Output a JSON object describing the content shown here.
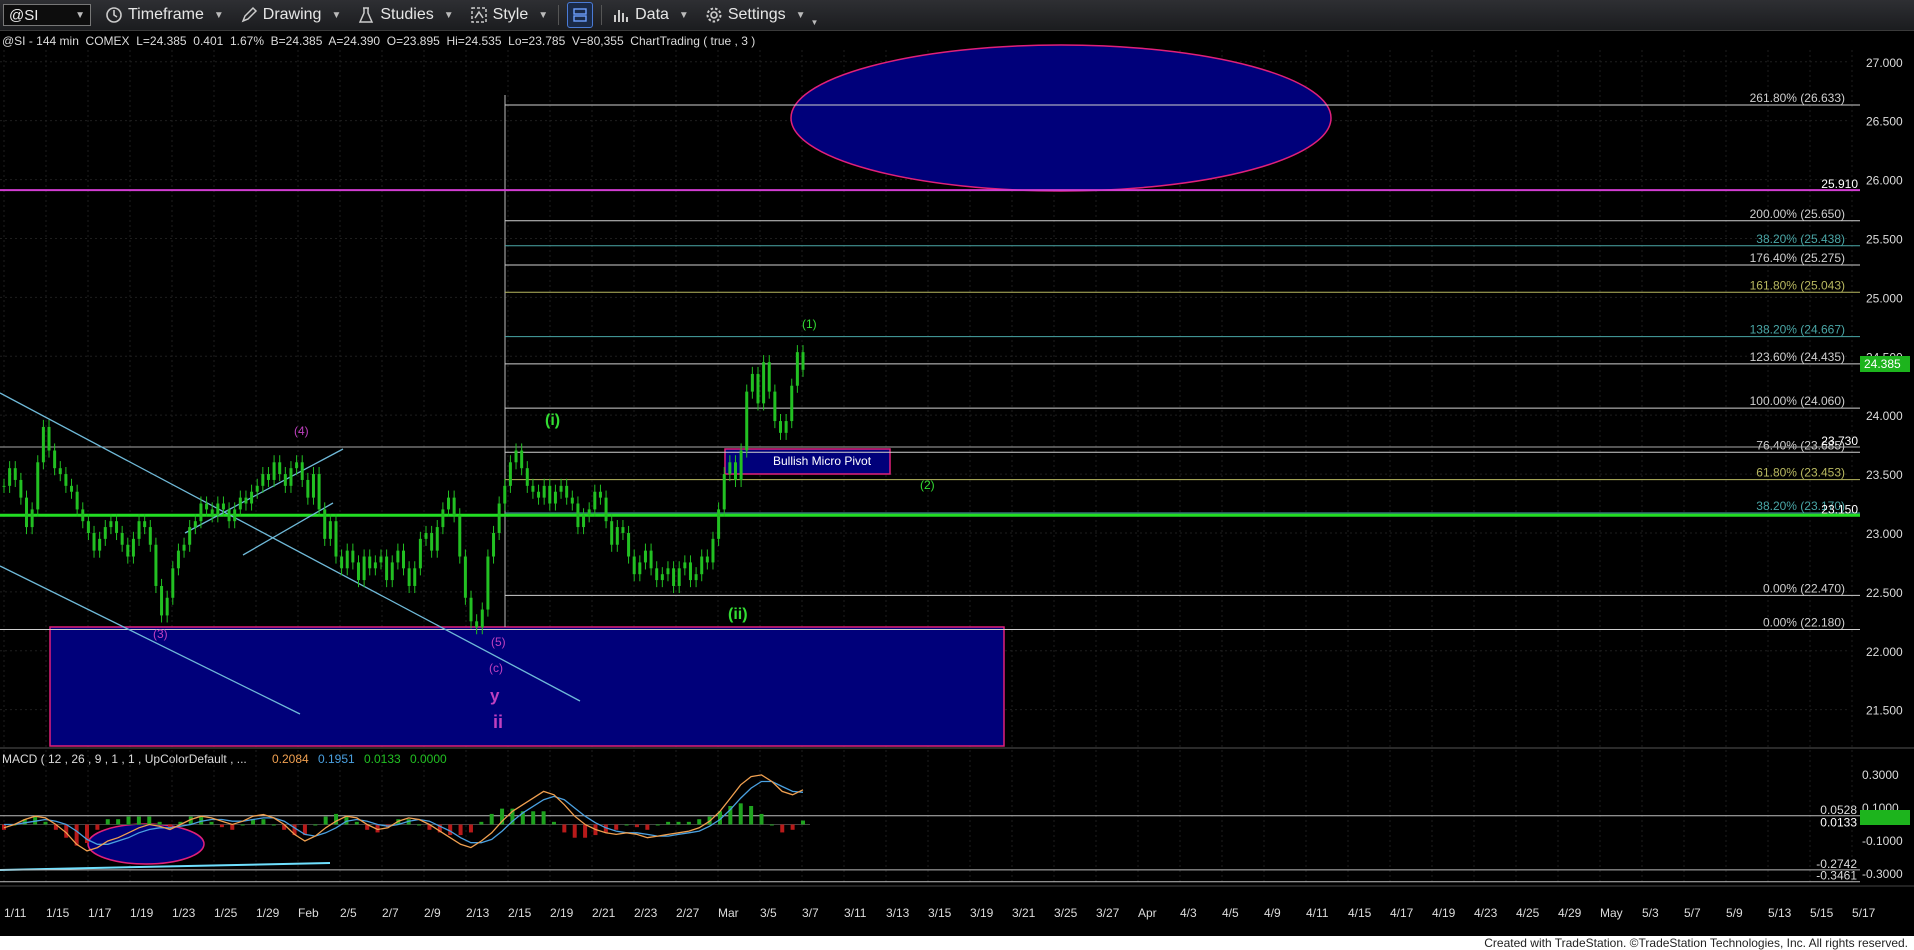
{
  "toolbar": {
    "symbol": "@SI",
    "timeframe_label": "Timeframe",
    "drawing_label": "Drawing",
    "studies_label": "Studies",
    "style_label": "Style",
    "data_label": "Data",
    "settings_label": "Settings"
  },
  "chart_header": "@SI - 144 min  COMEX  L=24.385  0.401  1.67%  B=24.385  A=24.390  O=23.895  Hi=24.535  Lo=23.785  V=80,355  ChartTrading ( true , 3 )",
  "macd_header": {
    "label": "MACD ( 12 , 26 , 9 , 1 , 1 , UpColorDefault , ...",
    "macd": "0.2084",
    "signal": "0.1951",
    "hist": "0.0133",
    "zero": "0.0000"
  },
  "footer": "Created with TradeStation. ©TradeStation Technologies, Inc. All rights reserved.",
  "colors": {
    "background": "#000000",
    "up_candle": "#22c022",
    "magenta_line": "#d23dd2",
    "green_line": "#22dd22",
    "zone_fill": "#00007a",
    "zone_border": "#e0207a",
    "label_green": "#33dd33",
    "label_magenta": "#c040c0",
    "trendline": "#6fb9d8",
    "macd_line": "#f0a050",
    "signal_line": "#4aa0e0"
  },
  "chart_data": [
    {
      "type": "line",
      "panel": "price",
      "symbol": "@SI",
      "interval": "144 min",
      "ylim": [
        21.2,
        27.1
      ],
      "y_ticks": [
        "27.000",
        "26.500",
        "26.000",
        "25.500",
        "25.000",
        "24.500",
        "24.000",
        "23.500",
        "23.000",
        "22.500",
        "22.000",
        "21.500"
      ],
      "x_ticks": [
        "1/11",
        "1/15",
        "1/17",
        "1/19",
        "1/23",
        "1/25",
        "1/29",
        "Feb",
        "2/5",
        "2/7",
        "2/9",
        "2/13",
        "2/15",
        "2/19",
        "2/21",
        "2/23",
        "2/27",
        "Mar",
        "3/5",
        "3/7",
        "3/11",
        "3/13",
        "3/15",
        "3/19",
        "3/21",
        "3/25",
        "3/27",
        "Apr",
        "4/3",
        "4/5",
        "4/9",
        "4/11",
        "4/15",
        "4/17",
        "4/19",
        "4/23",
        "4/25",
        "4/29",
        "May",
        "5/3",
        "5/7",
        "5/9",
        "5/13",
        "5/15",
        "5/17"
      ],
      "last_price": "24.385",
      "series": [
        {
          "values": [
            23.4,
            23.55,
            23.45,
            23.3,
            23.05,
            23.2,
            23.6,
            23.9,
            23.7,
            23.55,
            23.5,
            23.4,
            23.35,
            23.2,
            23.1,
            23.0,
            22.85,
            22.95,
            23.05,
            23.1,
            23.0,
            22.9,
            22.8,
            22.95,
            23.1,
            23.05,
            22.9,
            22.55,
            22.3,
            22.45,
            22.7,
            22.85,
            22.9,
            23.05,
            23.1,
            23.25,
            23.2,
            23.15,
            23.25,
            23.2,
            23.1,
            23.2,
            23.3,
            23.25,
            23.35,
            23.4,
            23.5,
            23.45,
            23.6,
            23.5,
            23.4,
            23.55,
            23.6,
            23.45,
            23.3,
            23.5,
            23.2,
            22.95,
            23.1,
            22.8,
            22.7,
            22.85,
            22.75,
            22.6,
            22.8,
            22.7,
            22.75,
            22.8,
            22.6,
            22.75,
            22.85,
            22.7,
            22.55,
            22.7,
            22.95,
            23.0,
            22.85,
            23.05,
            23.2,
            23.3,
            23.15,
            22.8,
            22.45,
            22.25,
            22.2,
            22.35,
            22.8,
            23.0,
            23.25,
            23.4,
            23.6,
            23.7,
            23.55,
            23.4,
            23.35,
            23.3,
            23.4,
            23.25,
            23.35,
            23.4,
            23.3,
            23.25,
            23.05,
            23.15,
            23.2,
            23.35,
            23.3,
            23.1,
            22.9,
            23.05,
            23.0,
            22.8,
            22.65,
            22.75,
            22.85,
            22.7,
            22.6,
            22.65,
            22.7,
            22.55,
            22.7,
            22.75,
            22.6,
            22.65,
            22.8,
            22.75,
            22.95,
            23.2,
            23.5,
            23.6,
            23.45,
            23.7,
            24.2,
            24.35,
            24.1,
            24.45,
            24.2,
            23.95,
            23.85,
            23.95,
            24.25,
            24.535,
            24.385
          ]
        }
      ],
      "fib_levels": [
        {
          "label": "261.80% (26.633)",
          "value": 26.633
        },
        {
          "label": "200.00% (25.650)",
          "value": 25.65
        },
        {
          "label": "38.20% (25.438)",
          "value": 25.438
        },
        {
          "label": "176.40% (25.275)",
          "value": 25.275
        },
        {
          "label": "161.80% (25.043)",
          "value": 25.043
        },
        {
          "label": "138.20% (24.667)",
          "value": 24.667
        },
        {
          "label": "123.60% (24.435)",
          "value": 24.435
        },
        {
          "label": "100.00% (24.060)",
          "value": 24.06
        },
        {
          "label": "76.40% (23.685)",
          "value": 23.685
        },
        {
          "label": "61.80% (23.453)",
          "value": 23.453
        },
        {
          "label": "38.20% (23.170)",
          "value": 23.17
        },
        {
          "label": "0.00% (22.470)",
          "value": 22.47
        },
        {
          "label": "0.00% (22.180)",
          "value": 22.18
        }
      ],
      "horizontal_lines": [
        {
          "label": "25.910",
          "value": 25.91,
          "color": "magenta"
        },
        {
          "label": "23.730",
          "value": 23.73,
          "color": "gray"
        },
        {
          "label": "23.150",
          "value": 23.15,
          "color": "green"
        }
      ],
      "annotations": [
        {
          "text": "(1)",
          "color": "green"
        },
        {
          "text": "(i)",
          "color": "green"
        },
        {
          "text": "(ii)",
          "color": "green"
        },
        {
          "text": "(2)",
          "color": "green"
        },
        {
          "text": "(4)",
          "color": "magenta"
        },
        {
          "text": "(3)",
          "color": "magenta"
        },
        {
          "text": "(5)",
          "color": "magenta"
        },
        {
          "text": "(c)",
          "color": "magenta"
        },
        {
          "text": "y",
          "color": "magenta"
        },
        {
          "text": "ii",
          "color": "magenta"
        },
        {
          "text": "Bullish Micro Pivot",
          "color": "white"
        }
      ],
      "zones": [
        {
          "shape": "ellipse",
          "y_range": [
            25.88,
            26.88
          ]
        },
        {
          "shape": "rectangle",
          "y_range": [
            21.2,
            22.18
          ]
        },
        {
          "shape": "rectangle",
          "y_range": [
            23.48,
            23.69
          ],
          "label": "Bullish Micro Pivot"
        }
      ]
    },
    {
      "type": "line",
      "panel": "indicator",
      "name": "MACD",
      "ylim": [
        -0.36,
        0.36
      ],
      "y_ticks": [
        "0.3000",
        "0.1000",
        "-0.1000",
        "-0.3000"
      ],
      "level_labels": [
        {
          "label": "0.0528",
          "value": 0.0528
        },
        {
          "label": "0.0133",
          "value": 0.0133
        },
        {
          "label": "-0.2742",
          "value": -0.2742
        },
        {
          "label": "-0.3461",
          "value": -0.3461
        }
      ],
      "series": [
        {
          "values": [
            -0.02,
            0.0,
            0.03,
            0.05,
            0.04,
            0.0,
            -0.05,
            -0.12,
            -0.16,
            -0.14,
            -0.1,
            -0.08,
            -0.05,
            -0.02,
            0.0,
            -0.01,
            -0.03,
            0.0,
            0.03,
            0.05,
            0.04,
            0.02,
            0.0,
            0.02,
            0.05,
            0.06,
            0.04,
            0.0,
            -0.06,
            -0.1,
            -0.07,
            -0.02,
            0.02,
            0.05,
            0.04,
            0.0,
            -0.03,
            -0.02,
            0.02,
            0.04,
            0.03,
            0.0,
            -0.04,
            -0.08,
            -0.12,
            -0.14,
            -0.1,
            -0.05,
            0.02,
            0.08,
            0.12,
            0.16,
            0.2,
            0.18,
            0.12,
            0.05,
            0.0,
            -0.03,
            -0.05,
            -0.06,
            -0.05,
            -0.06,
            -0.08,
            -0.07,
            -0.06,
            -0.05,
            -0.04,
            -0.02,
            0.02,
            0.08,
            0.16,
            0.24,
            0.29,
            0.3,
            0.26,
            0.2,
            0.18,
            0.21
          ]
        },
        {
          "values": [
            0.0,
            0.0,
            0.01,
            0.02,
            0.03,
            0.02,
            0.0,
            -0.04,
            -0.09,
            -0.12,
            -0.12,
            -0.1,
            -0.08,
            -0.05,
            -0.03,
            -0.02,
            -0.02,
            -0.01,
            0.0,
            0.02,
            0.03,
            0.03,
            0.02,
            0.02,
            0.03,
            0.04,
            0.04,
            0.02,
            -0.02,
            -0.06,
            -0.07,
            -0.05,
            -0.02,
            0.02,
            0.03,
            0.02,
            0.0,
            -0.01,
            0.0,
            0.02,
            0.03,
            0.02,
            -0.01,
            -0.04,
            -0.08,
            -0.11,
            -0.11,
            -0.09,
            -0.04,
            0.02,
            0.07,
            0.11,
            0.15,
            0.17,
            0.15,
            0.1,
            0.05,
            0.01,
            -0.02,
            -0.04,
            -0.05,
            -0.05,
            -0.06,
            -0.07,
            -0.07,
            -0.06,
            -0.05,
            -0.04,
            -0.01,
            0.03,
            0.09,
            0.16,
            0.22,
            0.26,
            0.26,
            0.23,
            0.2,
            0.195
          ]
        }
      ]
    }
  ]
}
